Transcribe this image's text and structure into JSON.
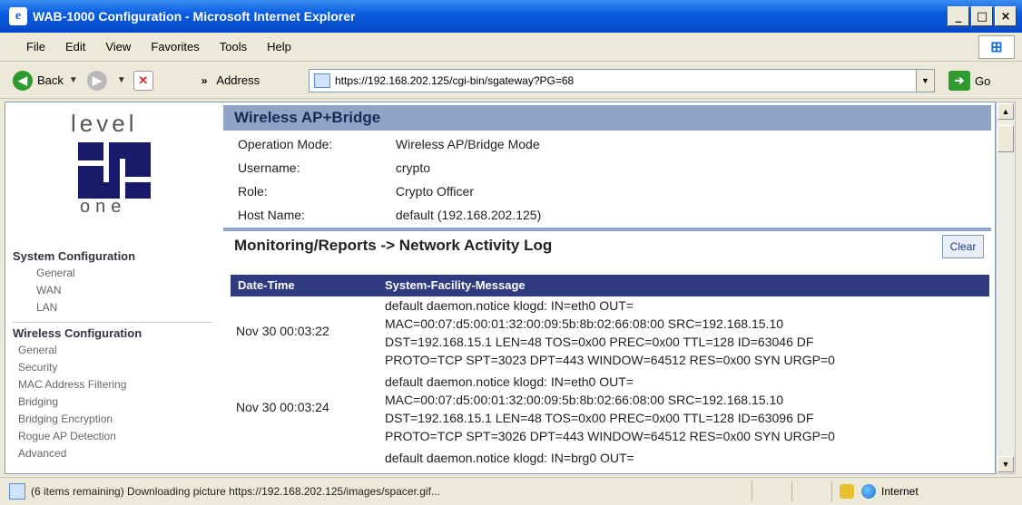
{
  "window": {
    "title": "WAB-1000 Configuration - Microsoft Internet Explorer",
    "buttons": [
      "_",
      "□",
      "×"
    ]
  },
  "menu": [
    "File",
    "Edit",
    "View",
    "Favorites",
    "Tools",
    "Help"
  ],
  "toolbar": {
    "back": "Back",
    "chevron": "»",
    "address_label": "Address",
    "url": "https://192.168.202.125/cgi-bin/sgateway?PG=68",
    "go": "Go"
  },
  "sidebar": {
    "logo_top": "level",
    "logo_bottom": "one",
    "groups": [
      {
        "title": "System Configuration",
        "items": [
          "General",
          "WAN",
          "LAN"
        ]
      },
      {
        "title": "Wireless Configuration",
        "items": [
          "General",
          "Security",
          "MAC Address Filtering",
          "Bridging",
          "Bridging Encryption",
          "Rogue AP Detection",
          "Advanced"
        ]
      }
    ]
  },
  "main": {
    "section_title": "Wireless AP+Bridge",
    "info": [
      {
        "label": "Operation Mode:",
        "value": "Wireless AP/Bridge Mode"
      },
      {
        "label": "Username:",
        "value": "crypto"
      },
      {
        "label": "Role:",
        "value": "Crypto Officer"
      },
      {
        "label": "Host Name:",
        "value": "default (192.168.202.125)"
      }
    ],
    "log_title": "Monitoring/Reports -> Network Activity Log",
    "clear_label": "Clear",
    "columns": [
      "Date-Time",
      "System-Facility-Message"
    ],
    "rows": [
      {
        "date": "Nov 30 00:03:22",
        "message": [
          "default daemon.notice klogd: IN=eth0 OUT=",
          "MAC=00:07:d5:00:01:32:00:09:5b:8b:02:66:08:00 SRC=192.168.15.10",
          "DST=192.168.15.1 LEN=48 TOS=0x00 PREC=0x00 TTL=128 ID=63046 DF",
          "PROTO=TCP SPT=3023 DPT=443 WINDOW=64512 RES=0x00 SYN URGP=0"
        ]
      },
      {
        "date": "Nov 30 00:03:24",
        "message": [
          "default daemon.notice klogd: IN=eth0 OUT=",
          "MAC=00:07:d5:00:01:32:00:09:5b:8b:02:66:08:00 SRC=192.168.15.10",
          "DST=192.168.15.1 LEN=48 TOS=0x00 PREC=0x00 TTL=128 ID=63096 DF",
          "PROTO=TCP SPT=3026 DPT=443 WINDOW=64512 RES=0x00 SYN URGP=0"
        ]
      },
      {
        "date": "",
        "message": [
          "default daemon.notice klogd: IN=brg0 OUT="
        ]
      }
    ]
  },
  "statusbar": {
    "text": "(6 items remaining) Downloading picture https://192.168.202.125/images/spacer.gif...",
    "zone": "Internet"
  }
}
